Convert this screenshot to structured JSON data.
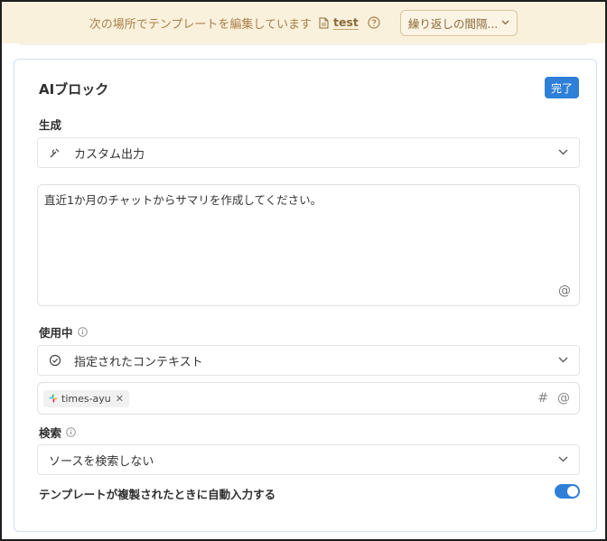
{
  "banner": {
    "text": "次の場所でテンプレートを編集しています",
    "page_name": "test",
    "repeat_label": "繰り返しの間隔..."
  },
  "block": {
    "title": "AIブロック",
    "done_label": "完了",
    "generate": {
      "label": "生成",
      "selected": "カスタム出力",
      "icon": "wand-icon"
    },
    "prompt": {
      "value": "直近1か月のチャットからサマリを作成してください。",
      "mention_symbol": "@"
    },
    "using": {
      "label": "使用中",
      "selected": "指定されたコンテキスト",
      "icon": "check-circle-icon",
      "chips": [
        {
          "label": "times-ayu"
        }
      ],
      "hash_symbol": "#",
      "mention_symbol": "@"
    },
    "search": {
      "label": "検索",
      "selected": "ソースを検索しない"
    },
    "autofill": {
      "label": "テンプレートが複製されたときに自動入力する",
      "enabled": true
    }
  },
  "colors": {
    "accent": "#2d7fd8",
    "banner_bg": "#faf1dc",
    "banner_text": "#a8804a"
  }
}
